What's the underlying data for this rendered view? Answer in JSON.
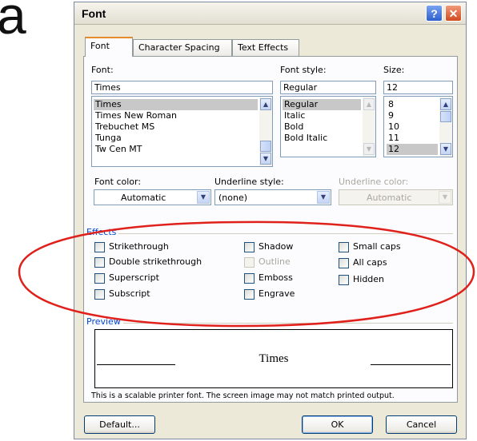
{
  "background_letter": "a",
  "dialog": {
    "title": "Font",
    "help_glyph": "?",
    "close_glyph": "✕"
  },
  "tabs": [
    {
      "label": "Font",
      "active": true
    },
    {
      "label": "Character Spacing",
      "active": false
    },
    {
      "label": "Text Effects",
      "active": false
    }
  ],
  "font": {
    "label": "Font:",
    "value": "Times",
    "items": [
      "Times",
      "Times New Roman",
      "Trebuchet MS",
      "Tunga",
      "Tw Cen MT"
    ],
    "selected": "Times"
  },
  "style": {
    "label": "Font style:",
    "value": "Regular",
    "items": [
      "Regular",
      "Italic",
      "Bold",
      "Bold Italic"
    ],
    "selected": "Regular"
  },
  "size": {
    "label": "Size:",
    "value": "12",
    "items": [
      "8",
      "9",
      "10",
      "11",
      "12"
    ],
    "selected": "12"
  },
  "font_color": {
    "label": "Font color:",
    "value": "Automatic"
  },
  "underline_style": {
    "label": "Underline style:",
    "value": "(none)"
  },
  "underline_color": {
    "label": "Underline color:",
    "value": "Automatic",
    "disabled": true
  },
  "effects": {
    "title": "Effects",
    "items": [
      {
        "label": "Strikethrough",
        "checked": false,
        "disabled": false
      },
      {
        "label": "Double strikethrough",
        "checked": false,
        "disabled": false
      },
      {
        "label": "Superscript",
        "checked": false,
        "disabled": false
      },
      {
        "label": "Subscript",
        "checked": false,
        "disabled": false
      },
      {
        "label": "Shadow",
        "checked": false,
        "disabled": false
      },
      {
        "label": "Outline",
        "checked": false,
        "disabled": true
      },
      {
        "label": "Emboss",
        "checked": false,
        "disabled": false
      },
      {
        "label": "Engrave",
        "checked": false,
        "disabled": false
      },
      {
        "label": "Small caps",
        "checked": false,
        "disabled": false
      },
      {
        "label": "All caps",
        "checked": false,
        "disabled": false
      },
      {
        "label": "Hidden",
        "checked": false,
        "disabled": false
      }
    ]
  },
  "preview": {
    "title": "Preview",
    "text": "Times",
    "note": "This is a scalable printer font. The screen image may not match printed output."
  },
  "buttons": {
    "default": "Default...",
    "ok": "OK",
    "cancel": "Cancel"
  },
  "colors": {
    "highlight_ellipse": "#e0201b",
    "group_title": "#0046d5",
    "tab_accent": "#e68b2c"
  },
  "icons": {
    "scroll_up": "▲",
    "scroll_down": "▼",
    "dropdown": "▼"
  }
}
